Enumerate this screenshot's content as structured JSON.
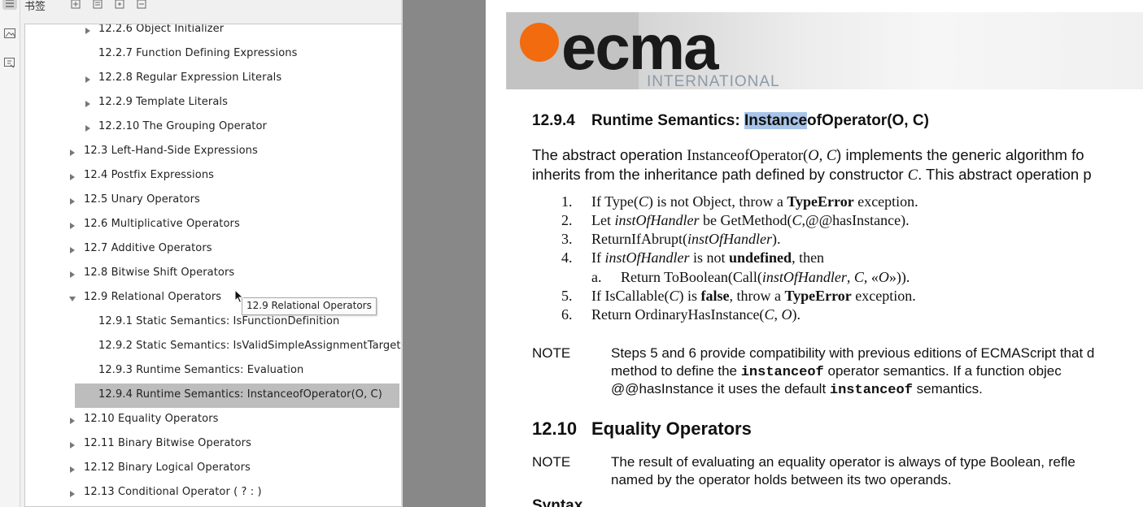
{
  "strip": {
    "icons": [
      "outline-icon",
      "thumbnail-icon",
      "annotation-icon"
    ]
  },
  "sidebar": {
    "title": "书签",
    "tools": [
      "add-bookmark-icon",
      "add-child-bookmark-icon",
      "expand-bookmark-icon",
      "delete-bookmark-icon"
    ],
    "items": [
      {
        "label": "12.2.6 Object Initializer",
        "expandable": true,
        "expanded": false,
        "level": 2
      },
      {
        "label": "12.2.7 Function Defining Expressions",
        "expandable": false,
        "level": 2
      },
      {
        "label": "12.2.8 Regular Expression Literals",
        "expandable": true,
        "expanded": false,
        "level": 2
      },
      {
        "label": "12.2.9 Template Literals",
        "expandable": true,
        "expanded": false,
        "level": 2
      },
      {
        "label": "12.2.10 The Grouping Operator",
        "expandable": true,
        "expanded": false,
        "level": 2
      },
      {
        "label": "12.3 Left-Hand-Side Expressions",
        "expandable": true,
        "expanded": false,
        "level": 1
      },
      {
        "label": "12.4 Postfix Expressions",
        "expandable": true,
        "expanded": false,
        "level": 1
      },
      {
        "label": "12.5 Unary Operators",
        "expandable": true,
        "expanded": false,
        "level": 1
      },
      {
        "label": "12.6 Multiplicative Operators",
        "expandable": true,
        "expanded": false,
        "level": 1
      },
      {
        "label": "12.7 Additive Operators",
        "expandable": true,
        "expanded": false,
        "level": 1
      },
      {
        "label": "12.8 Bitwise Shift Operators",
        "expandable": true,
        "expanded": false,
        "level": 1
      },
      {
        "label": "12.9 Relational Operators",
        "expandable": true,
        "expanded": true,
        "level": 1
      },
      {
        "label": "12.9.1 Static Semantics:  IsFunctionDefinition",
        "expandable": false,
        "level": 2
      },
      {
        "label": "12.9.2 Static Semantics:  IsValidSimpleAssignmentTarget",
        "expandable": false,
        "level": 2
      },
      {
        "label": "12.9.3 Runtime Semantics: Evaluation",
        "expandable": false,
        "level": 2
      },
      {
        "label": "12.9.4 Runtime Semantics: InstanceofOperator(O, C)",
        "expandable": false,
        "level": 2,
        "selected": true
      },
      {
        "label": "12.10 Equality Operators",
        "expandable": true,
        "expanded": false,
        "level": 1
      },
      {
        "label": "12.11 Binary Bitwise Operators",
        "expandable": true,
        "expanded": false,
        "level": 1
      },
      {
        "label": "12.12 Binary Logical Operators",
        "expandable": true,
        "expanded": false,
        "level": 1
      },
      {
        "label": "12.13 Conditional Operator ( ? : )",
        "expandable": true,
        "expanded": false,
        "level": 1
      }
    ],
    "tooltip": "12.9 Relational Operators"
  },
  "document": {
    "logo_text": "ecma",
    "logo_sub": "INTERNATIONAL",
    "section1": {
      "number": "12.9.4",
      "title_pre": "Runtime Semantics: ",
      "title_highlight": "Instance",
      "title_post": "ofOperator(O, C)"
    },
    "intro_line1_a": "The abstract operation ",
    "intro_line1_b": "InstanceofOperator(",
    "intro_line1_c": "O",
    "intro_line1_d": ", ",
    "intro_line1_e": "C",
    "intro_line1_f": ") implements the generic algorithm fo",
    "intro_line2_a": "inherits from the inheritance path defined by constructor ",
    "intro_line2_b": "C",
    "intro_line2_c": ". This abstract operation p",
    "steps": [
      {
        "num": "1.",
        "html": "If Type(<i>C</i>) is not Object, throw a <b>TypeError</b> exception."
      },
      {
        "num": "2.",
        "html": "Let <i>instOfHandler</i> be GetMethod(<i>C</i>,@@hasInstance)."
      },
      {
        "num": "3.",
        "html": "ReturnIfAbrupt(<i>instOfHandler</i>)."
      },
      {
        "num": "4.",
        "html": "If <i>instOfHandler</i> is not <b>undefined</b>, then"
      },
      {
        "num": "a.",
        "html": "Return ToBoolean(Call(<i>instOfHandler</i>, <i>C</i>, «<i>O</i>»))."
      },
      {
        "num": "5.",
        "html": "If IsCallable(<i>C</i>) is <b>false</b>, throw a <b>TypeError</b> exception."
      },
      {
        "num": "6.",
        "html": "Return OrdinaryHasInstance(<i>C</i>, <i>O</i>)."
      }
    ],
    "note1_label": "NOTE",
    "note1_line1": "Steps 5 and 6 provide compatibility with previous editions of ECMAScript that d",
    "note1_line2_a": "method to define the ",
    "note1_line2_b": "instanceof",
    "note1_line2_c": " operator semantics. If a function objec",
    "note1_line3_a": "@@hasInstance it uses the default ",
    "note1_line3_b": "instanceof",
    "note1_line3_c": " semantics.",
    "section2": {
      "number": "12.10",
      "title": "Equality Operators"
    },
    "note2_label": "NOTE",
    "note2_line1": "The result of evaluating an equality operator is always of type Boolean, refle",
    "note2_line2": "named by the operator holds between its two operands.",
    "syntax_heading": "Syntax"
  }
}
